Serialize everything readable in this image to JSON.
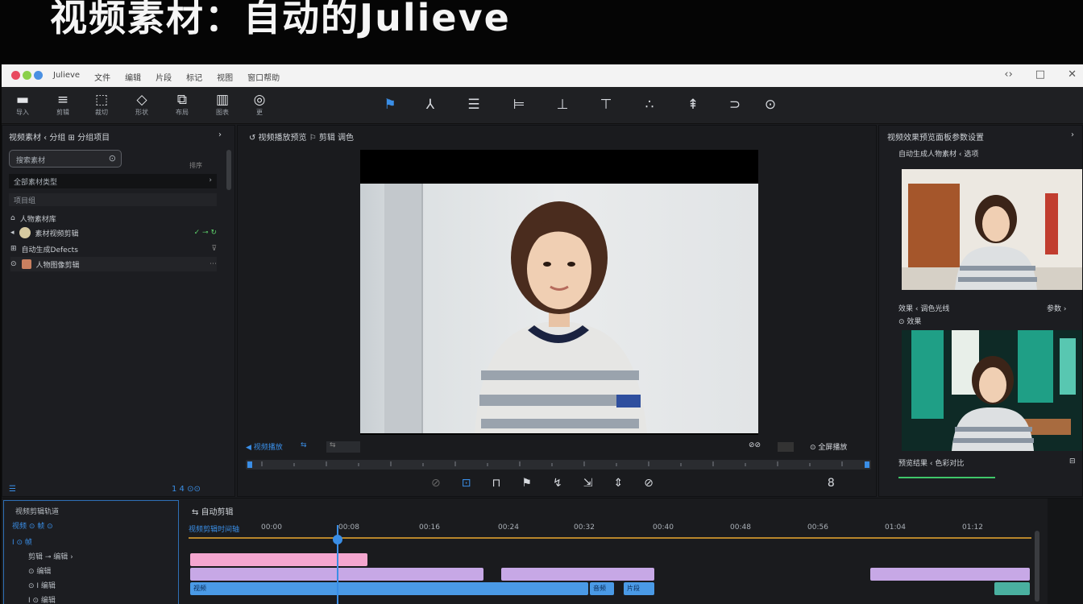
{
  "banner": {
    "title": "视频素材：自动的Julieve"
  },
  "titlebar": {
    "menus": [
      "Julieve",
      "文件",
      "编辑",
      "片段",
      "标记",
      "视图",
      "窗口帮助"
    ],
    "controls": [
      "‹›",
      "□",
      "✕"
    ]
  },
  "toolbar": {
    "left_tools": [
      {
        "icon": "▬",
        "label": "导入"
      },
      {
        "icon": "≡",
        "label": "剪辑"
      },
      {
        "icon": "⬚",
        "label": "裁切"
      },
      {
        "icon": "◇",
        "label": "形状"
      },
      {
        "icon": "⧉",
        "label": "布局"
      },
      {
        "icon": "▥",
        "label": "图表"
      },
      {
        "icon": "◎",
        "label": "更"
      }
    ],
    "center_tools": [
      "⚑",
      "⅄",
      "☰",
      "⊨",
      "⊥",
      "⊤",
      "∴",
      "⇞",
      "⊃",
      "⊙"
    ]
  },
  "left_panel": {
    "title": "视频素材  ‹ 分组  ⊞  分组项目",
    "search_placeholder": "搜索素材",
    "filter_label": "全部素材类型",
    "filter_right": "排序",
    "section_label": "项目组",
    "assets": [
      {
        "name": "人物素材库",
        "tail": ""
      },
      {
        "name": "素材视频剪辑",
        "tail": "✓  ⊸  ↻"
      },
      {
        "name": "自动生成Defects",
        "tail": "⊽"
      },
      {
        "name": "人物图像剪辑",
        "tail": "⋯"
      }
    ],
    "footer_left": "☰",
    "footer_right": "1 4   ⊙⊙"
  },
  "viewer": {
    "title": "↺  视频播放预览      ⚐   剪辑    调色",
    "bar_left": "◀ 视频播放",
    "bar_right": "⊙ 全屏播放",
    "transport": [
      "⊘",
      "⊡",
      "⊓",
      "⚑",
      "↯",
      "⇲",
      "⇕",
      "⊘",
      "8"
    ]
  },
  "right_panel": {
    "title": "视频效果预览面板参数设置",
    "sub1": "自动生成人物素材  ‹ 选项",
    "label2_left": "效果 ‹ 调色光线",
    "label2_right": "参数 ›",
    "sub3": "⊙ 效果",
    "label3_left": "预览结果  ‹ 色彩对比",
    "label3_right": "⊟"
  },
  "timeline": {
    "head_title": "视频剪辑轨道",
    "rows": [
      "视频  ⊙ 帧 ⊙",
      "  Ⅰ  ⊙  帧",
      "剪辑  ⊸  编辑  ›",
      "   ⊙    编辑",
      "  ⊙  Ⅰ  编辑",
      "  Ⅰ  ⊙  编辑"
    ],
    "top_label": "⇆ 自动剪辑",
    "ruler_ticks": [
      "视频剪辑时间轴",
      "00:00",
      "00:08",
      "00:16",
      "00:24",
      "00:32",
      "00:40",
      "00:48",
      "00:56",
      "01:04",
      "01:12"
    ],
    "clips": [
      "",
      "视频",
      "音频",
      "片段"
    ]
  },
  "colors": {
    "accent": "#3a8ee6",
    "clip_pink": "#f4a6cf",
    "clip_lavender": "#c7a8e6",
    "clip_blue": "#4a9ae6"
  }
}
